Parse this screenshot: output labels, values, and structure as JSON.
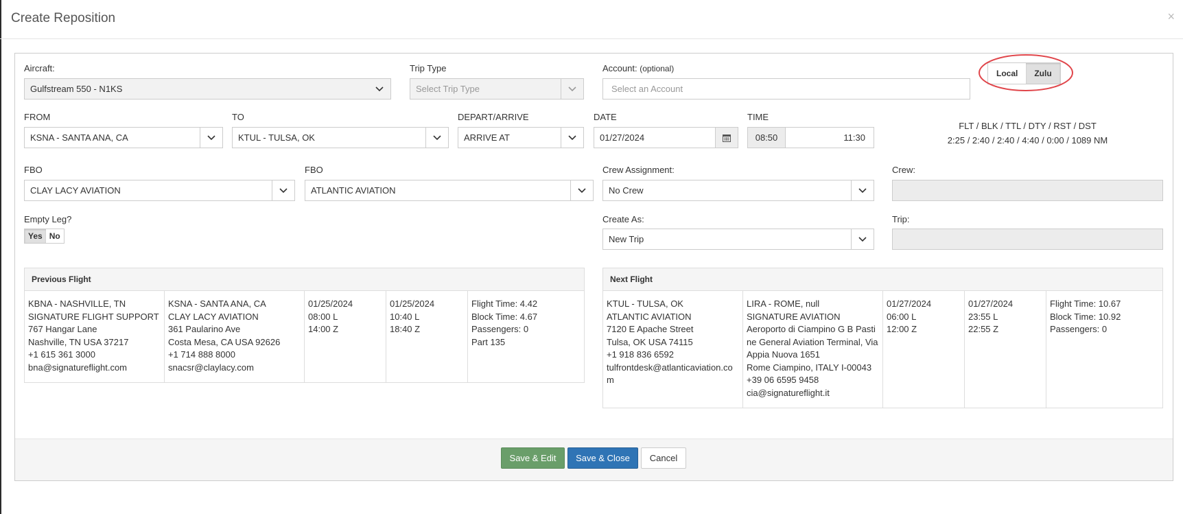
{
  "modal": {
    "title": "Create Reposition",
    "close": "×"
  },
  "fields": {
    "aircraft": {
      "label": "Aircraft:",
      "value": "Gulfstream 550 - N1KS"
    },
    "trip_type": {
      "label": "Trip Type",
      "placeholder": "Select Trip Type"
    },
    "account": {
      "label": "Account:",
      "label_hint": "(optional)",
      "placeholder": "Select an Account"
    },
    "from": {
      "label": "FROM",
      "value": "KSNA - SANTA ANA, CA"
    },
    "to": {
      "label": "TO",
      "value": "KTUL - TULSA, OK"
    },
    "depart_arrive": {
      "label": "DEPART/ARRIVE",
      "value": "ARRIVE AT"
    },
    "date": {
      "label": "DATE",
      "value": "01/27/2024"
    },
    "time": {
      "label": "TIME",
      "left_value": "08:50",
      "value": "11:30"
    },
    "fbo_from": {
      "label": "FBO",
      "value": "CLAY LACY AVIATION"
    },
    "fbo_to": {
      "label": "FBO",
      "value": "ATLANTIC AVIATION"
    },
    "crew_assignment": {
      "label": "Crew Assignment:",
      "value": "No Crew"
    },
    "crew": {
      "label": "Crew:"
    },
    "empty_leg": {
      "label": "Empty Leg?",
      "yes": "Yes",
      "no": "No"
    },
    "create_as": {
      "label": "Create As:",
      "value": "New Trip"
    },
    "trip": {
      "label": "Trip:"
    }
  },
  "time_mode": {
    "local": "Local",
    "zulu": "Zulu",
    "selected": "Zulu"
  },
  "stats": {
    "header": "FLT / BLK / TTL / DTY / RST / DST",
    "values": "2:25 / 2:40 / 2:40 / 4:40 / 0:00 / 1089 NM"
  },
  "previous_flight": {
    "title": "Previous Flight",
    "columns": [
      [
        "KBNA - NASHVILLE, TN",
        "SIGNATURE FLIGHT SUPPORT",
        "767 Hangar Lane",
        "Nashville, TN USA 37217",
        "+1 615 361 3000",
        "bna@signatureflight.com"
      ],
      [
        "KSNA - SANTA ANA, CA",
        "CLAY LACY AVIATION",
        "361 Paularino Ave",
        "Costa Mesa, CA USA 92626",
        "+1 714 888 8000",
        "snacsr@claylacy.com"
      ],
      [
        "01/25/2024",
        "08:00 L",
        "14:00 Z"
      ],
      [
        "01/25/2024",
        "10:40 L",
        "18:40 Z"
      ],
      [
        "Flight Time: 4.42",
        "Block Time: 4.67",
        "Passengers: 0",
        "Part 135"
      ]
    ]
  },
  "next_flight": {
    "title": "Next Flight",
    "columns": [
      [
        "KTUL - TULSA, OK",
        "ATLANTIC AVIATION",
        "7120 E Apache Street",
        "Tulsa, OK USA 74115",
        "+1 918 836 6592",
        "tulfrontdesk@atlanticaviation.com"
      ],
      [
        "LIRA - ROME, null",
        "SIGNATURE AVIATION",
        "Aeroporto di Ciampino G B Pastine General Aviation Terminal, Via Appia Nuova 1651",
        "Rome Ciampino, ITALY I-00043",
        "+39 06 6595 9458",
        "cia@signatureflight.it"
      ],
      [
        "01/27/2024",
        "06:00 L",
        "12:00 Z"
      ],
      [
        "01/27/2024",
        "23:55 L",
        "22:55 Z"
      ],
      [
        "Flight Time: 10.67",
        "Block Time: 10.92",
        "Passengers: 0"
      ]
    ]
  },
  "buttons": {
    "save_edit": "Save & Edit",
    "save_close": "Save & Close",
    "cancel": "Cancel"
  },
  "colors": {
    "save_edit": "#6a9e6a",
    "save_close": "#2f74b5",
    "annotation": "#e0454a"
  }
}
